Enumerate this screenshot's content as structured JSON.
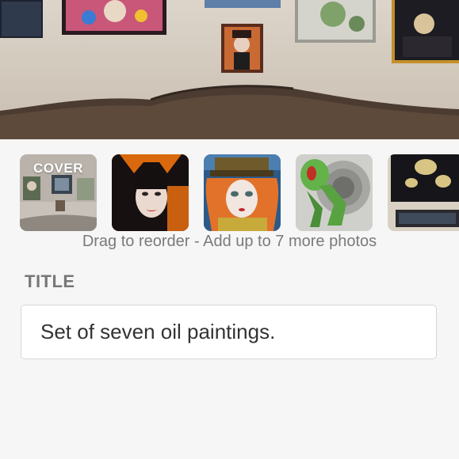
{
  "hero": {
    "photo_description_icon": "gallery-wall-photo"
  },
  "photos": {
    "cover_label": "COVER",
    "items": [
      {
        "icon": "gallery-wall-thumbnail"
      },
      {
        "icon": "maleficent-painting-thumbnail"
      },
      {
        "icon": "mad-hatter-painting-thumbnail"
      },
      {
        "icon": "green-alien-painting-thumbnail"
      },
      {
        "icon": "dark-abstract-painting-thumbnail"
      }
    ],
    "hint": "Drag to reorder - Add up to 7 more photos"
  },
  "title_field": {
    "label": "TITLE",
    "value": "Set of seven oil paintings."
  },
  "colors": {
    "background": "#f6f6f6",
    "label_gray": "#777777",
    "hint_gray": "#7a7a7a",
    "input_border": "#d6d6d6"
  }
}
